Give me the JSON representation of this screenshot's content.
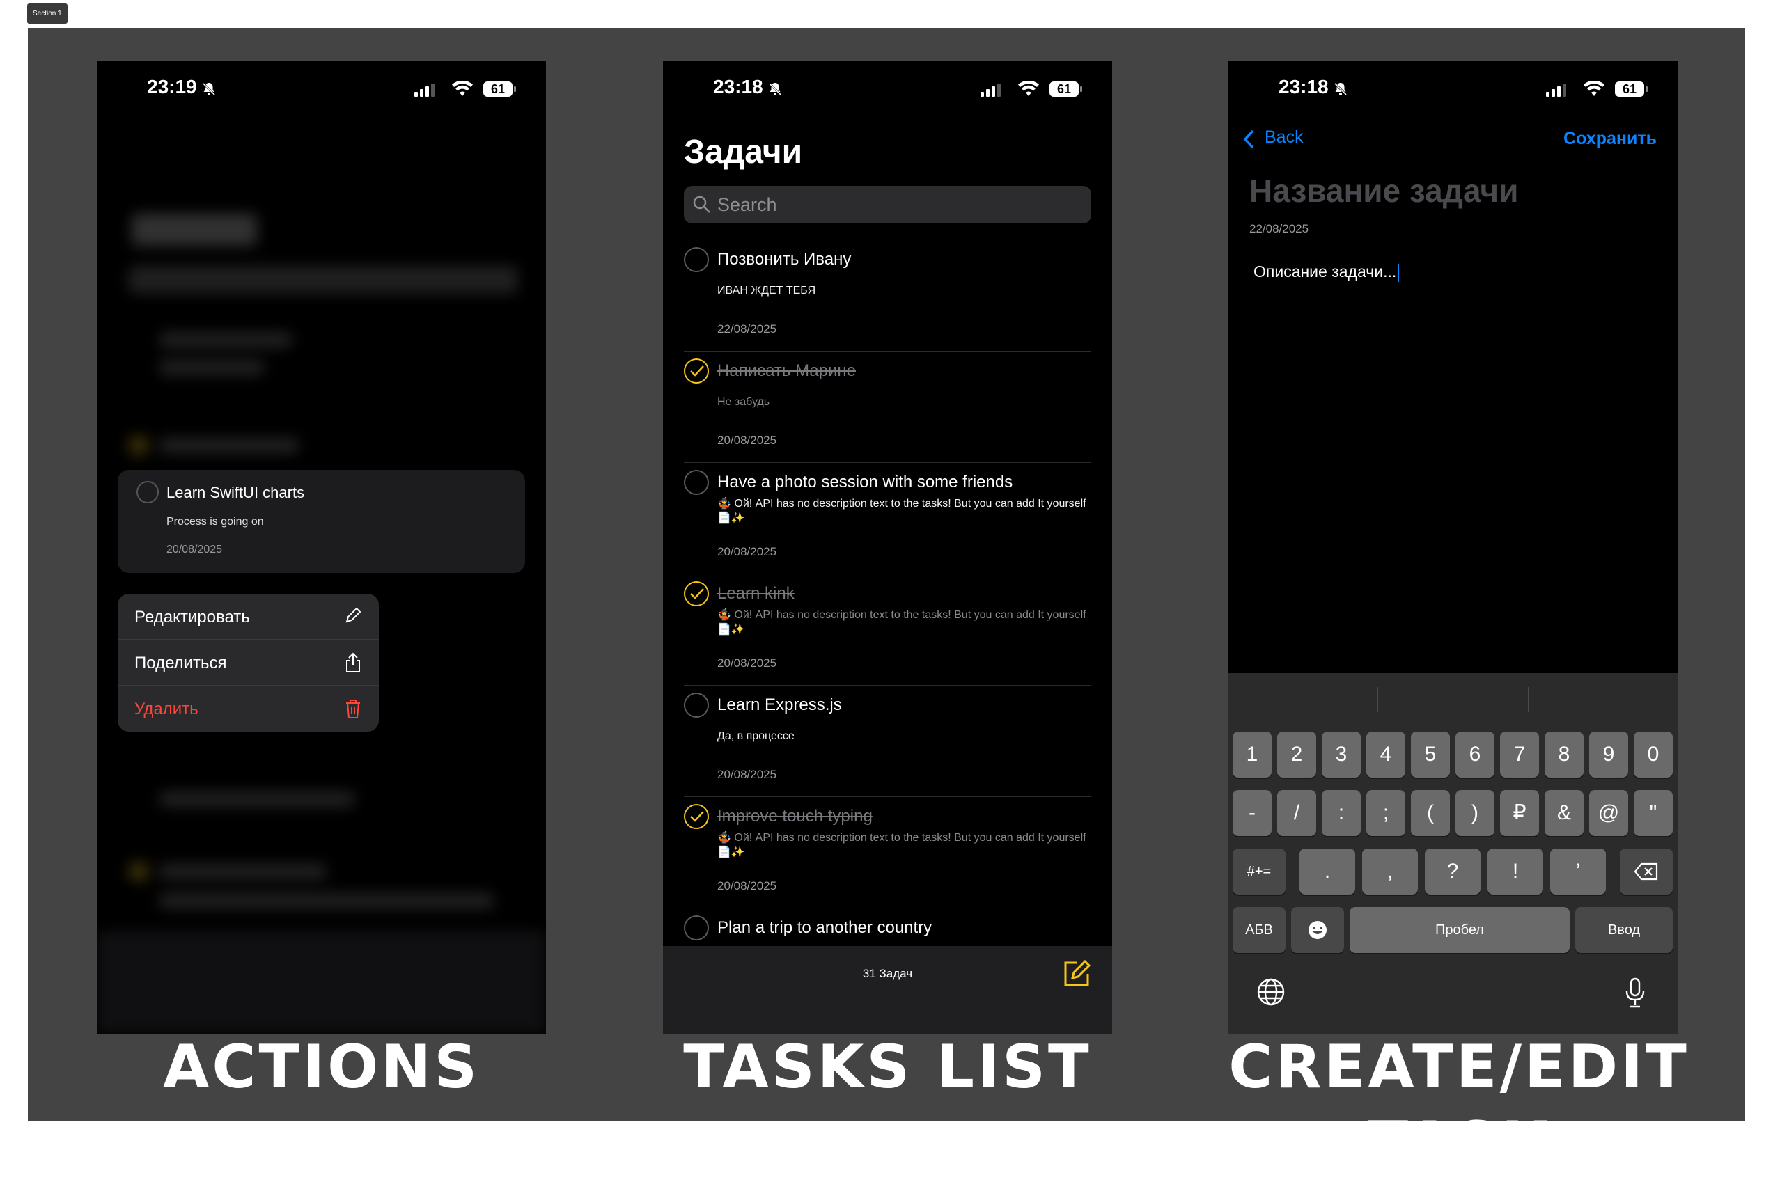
{
  "section_tag": "Section 1",
  "captions": [
    "ACTIONS",
    "TASKS LIST",
    "CREATE/EDIT TASK"
  ],
  "status": [
    {
      "time": "23:19",
      "battery": "61"
    },
    {
      "time": "23:18",
      "battery": "61"
    },
    {
      "time": "23:18",
      "battery": "61"
    }
  ],
  "actions": {
    "card": {
      "title": "Learn SwiftUI charts",
      "description": "Process is going on",
      "date": "20/08/2025"
    },
    "menu": [
      {
        "label": "Редактировать",
        "icon": "pencil-icon"
      },
      {
        "label": "Поделиться",
        "icon": "share-icon"
      },
      {
        "label": "Удалить",
        "icon": "trash-icon",
        "destructive": true
      }
    ]
  },
  "list": {
    "title": "Задачи",
    "search_placeholder": "Search",
    "tasks": [
      {
        "title": "Позвонить Ивану",
        "description": "ИВАН ЖДЕТ ТЕБЯ",
        "date": "22/08/2025",
        "done": false
      },
      {
        "title": "Написать Марине",
        "description": "Не забудь",
        "date": "20/08/2025",
        "done": true
      },
      {
        "title": "Have a photo session with some friends",
        "description": "🤹 Ой! API has no description text to the tasks! But you can add It yourself 📄✨",
        "date": "20/08/2025",
        "done": false
      },
      {
        "title": "Learn kink",
        "description": "🤹 Ой! API has no description text to the tasks! But you can add It yourself 📄✨",
        "date": "20/08/2025",
        "done": true
      },
      {
        "title": "Learn Express.js",
        "description": "Да, в процессе",
        "date": "20/08/2025",
        "done": false
      },
      {
        "title": "Improve touch typing",
        "description": "🤹 Ой! API has no description text to the tasks! But you can add It yourself 📄✨",
        "date": "20/08/2025",
        "done": true
      },
      {
        "title": "Plan a trip to another country",
        "description": "",
        "date": "",
        "done": false
      }
    ],
    "count": "31 Задач"
  },
  "edit": {
    "back": "Back",
    "save": "Сохранить",
    "title_placeholder": "Название задачи",
    "date": "22/08/2025",
    "description": "Описание задачи...",
    "keyboard": {
      "row1": [
        "1",
        "2",
        "3",
        "4",
        "5",
        "6",
        "7",
        "8",
        "9",
        "0"
      ],
      "row2": [
        "-",
        "/",
        ":",
        ";",
        "(",
        ")",
        "₽",
        "&",
        "@",
        "\""
      ],
      "row3_left": "#+=",
      "row3": [
        ".",
        ",",
        "?",
        "!",
        "’"
      ],
      "abc": "АБВ",
      "space": "Пробел",
      "enter": "Ввод"
    }
  }
}
